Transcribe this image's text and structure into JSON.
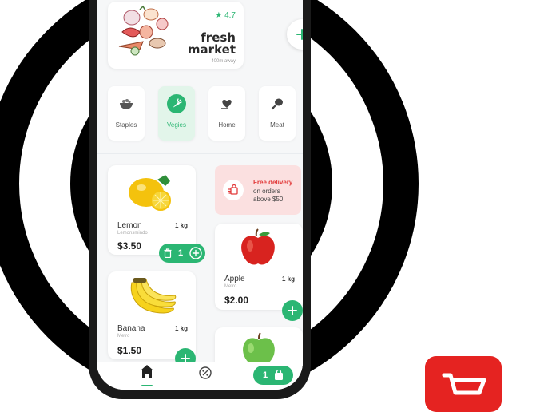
{
  "store": {
    "rating": "★ 4.7",
    "name_line1": "fresh",
    "name_line2": "market",
    "distance": "400m away"
  },
  "categories": [
    {
      "label": "Staples",
      "icon": "bowl-icon",
      "active": false
    },
    {
      "label": "Vegies",
      "icon": "carrot-icon",
      "active": true
    },
    {
      "label": "Home",
      "icon": "heart-hand-icon",
      "active": false
    },
    {
      "label": "Meat",
      "icon": "drumstick-icon",
      "active": false
    }
  ],
  "promo": {
    "title": "Free delivery",
    "line1": "on orders",
    "line2": "above $50"
  },
  "products": [
    {
      "name": "Lemon",
      "subtitle": "Lemonsmindo",
      "weight": "1 kg",
      "price": "$3.50",
      "quantity": "1"
    },
    {
      "name": "Apple",
      "subtitle": "Metro",
      "weight": "1 kg",
      "price": "$2.00"
    },
    {
      "name": "Banana",
      "subtitle": "Metro",
      "weight": "1 kg",
      "price": "$1.50"
    },
    {
      "name": "",
      "subtitle": "",
      "weight": "",
      "price": ""
    }
  ],
  "cart": {
    "count": "1"
  },
  "colors": {
    "accent": "#2bb673",
    "promo_bg": "#fbe0e0",
    "promo_text": "#e23b3b",
    "app_icon_bg": "#e52321"
  }
}
